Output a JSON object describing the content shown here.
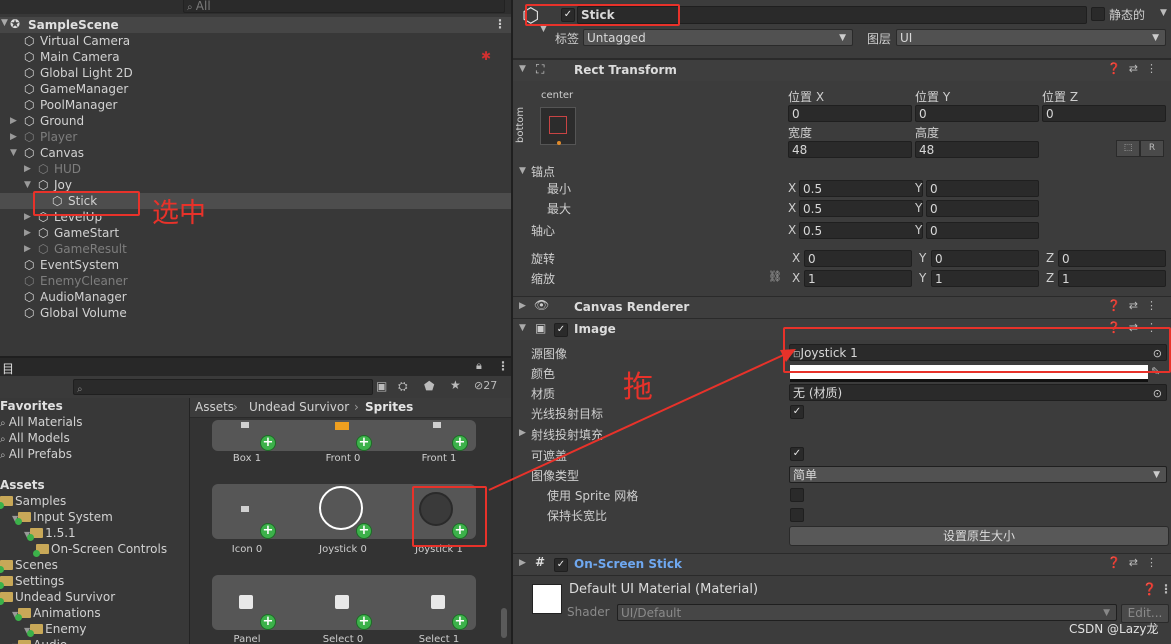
{
  "hierarchy": {
    "search_placeholder": "All",
    "scene": "SampleScene",
    "items": [
      {
        "label": "Virtual Camera",
        "indent": 1,
        "arrow": "",
        "dim": false
      },
      {
        "label": "Main Camera",
        "indent": 1,
        "arrow": "",
        "dim": false
      },
      {
        "label": "Global Light 2D",
        "indent": 1,
        "arrow": "",
        "dim": false
      },
      {
        "label": "GameManager",
        "indent": 1,
        "arrow": "",
        "dim": false
      },
      {
        "label": "PoolManager",
        "indent": 1,
        "arrow": "",
        "dim": false
      },
      {
        "label": "Ground",
        "indent": 1,
        "arrow": "▶",
        "dim": false
      },
      {
        "label": "Player",
        "indent": 1,
        "arrow": "▶",
        "dim": true
      },
      {
        "label": "Canvas",
        "indent": 1,
        "arrow": "▼",
        "dim": false
      },
      {
        "label": "HUD",
        "indent": 2,
        "arrow": "▶",
        "dim": true
      },
      {
        "label": "Joy",
        "indent": 2,
        "arrow": "▼",
        "dim": false
      },
      {
        "label": "Stick",
        "indent": 3,
        "arrow": "",
        "dim": false
      },
      {
        "label": "LevelUp",
        "indent": 2,
        "arrow": "▶",
        "dim": false
      },
      {
        "label": "GameStart",
        "indent": 2,
        "arrow": "▶",
        "dim": false
      },
      {
        "label": "GameResult",
        "indent": 2,
        "arrow": "▶",
        "dim": true
      },
      {
        "label": "EventSystem",
        "indent": 1,
        "arrow": "",
        "dim": false
      },
      {
        "label": "EnemyCleaner",
        "indent": 1,
        "arrow": "",
        "dim": true
      },
      {
        "label": "AudioManager",
        "indent": 1,
        "arrow": "",
        "dim": false
      },
      {
        "label": "Global Volume",
        "indent": 1,
        "arrow": "",
        "dim": false
      }
    ],
    "annotation_selected": "选中"
  },
  "project": {
    "tab_label": "目",
    "badge_count": "27",
    "favorites_title": "Favorites",
    "favorites": [
      "All Materials",
      "All Models",
      "All Prefabs"
    ],
    "assets_title": "Assets",
    "tree": [
      {
        "label": "Samples",
        "indent": 0
      },
      {
        "label": "Input System",
        "indent": 1
      },
      {
        "label": "1.5.1",
        "indent": 2
      },
      {
        "label": "On-Screen Controls",
        "indent": 3
      },
      {
        "label": "Scenes",
        "indent": 0
      },
      {
        "label": "Settings",
        "indent": 0
      },
      {
        "label": "Undead Survivor",
        "indent": 0
      },
      {
        "label": "Animations",
        "indent": 1
      },
      {
        "label": "Enemy",
        "indent": 2
      },
      {
        "label": "Audio",
        "indent": 1
      }
    ],
    "breadcrumb": [
      "Assets",
      "Undead Survivor",
      "Sprites"
    ],
    "sprites_row1": [
      "Box 1",
      "Front 0",
      "Front 1"
    ],
    "sprites_row2": [
      "Icon 0",
      "Joystick 0",
      "Joystick 1"
    ],
    "sprites_row3": [
      "Panel",
      "Select 0",
      "Select 1"
    ]
  },
  "inspector": {
    "object_name": "Stick",
    "static_label": "静态的",
    "tag_label": "标签",
    "tag_value": "Untagged",
    "layer_label": "图层",
    "layer_value": "UI",
    "rect_transform": {
      "title": "Rect Transform",
      "anchor_h": "center",
      "anchor_v": "bottom",
      "pos_x_label": "位置 X",
      "pos_y_label": "位置 Y",
      "pos_z_label": "位置 Z",
      "pos_x": "0",
      "pos_y": "0",
      "pos_z": "0",
      "width_label": "宽度",
      "height_label": "高度",
      "width": "48",
      "height": "48",
      "r_button": "R",
      "anchors_label": "锚点",
      "min_label": "最小",
      "max_label": "最大",
      "min_x": "0.5",
      "min_y": "0",
      "max_x": "0.5",
      "max_y": "0",
      "pivot_label": "轴心",
      "pivot_x": "0.5",
      "pivot_y": "0",
      "rotation_label": "旋转",
      "rot_x": "0",
      "rot_y": "0",
      "rot_z": "0",
      "scale_label": "缩放",
      "scale_x": "1",
      "scale_y": "1",
      "scale_z": "1",
      "x": "X",
      "y": "Y",
      "z": "Z"
    },
    "canvas_renderer": {
      "title": "Canvas Renderer"
    },
    "image": {
      "title": "Image",
      "source_label": "源图像",
      "source_value": "Joystick 1",
      "color_label": "颜色",
      "material_label": "材质",
      "material_value": "无 (材质)",
      "raycast_target_label": "光线投射目标",
      "raycast_padding_label": "射线投射填充",
      "maskable_label": "可遮盖",
      "image_type_label": "图像类型",
      "image_type_value": "简单",
      "use_sprite_mesh_label": "使用 Sprite 网格",
      "preserve_aspect_label": "保持长宽比",
      "set_native_size": "设置原生大小"
    },
    "onscreen_stick": {
      "title": "On-Screen Stick"
    },
    "default_material": {
      "title": "Default UI Material (Material)",
      "shader_label": "Shader",
      "shader_value": "UI/Default",
      "edit_button": "Edit..."
    },
    "annotation_drag": "拖"
  },
  "watermark": "CSDN @Lazy龙",
  "colors": {
    "annotation_red": "#e8322a",
    "plus_green": "#3cb14a",
    "link_blue": "#6fa8f0"
  }
}
